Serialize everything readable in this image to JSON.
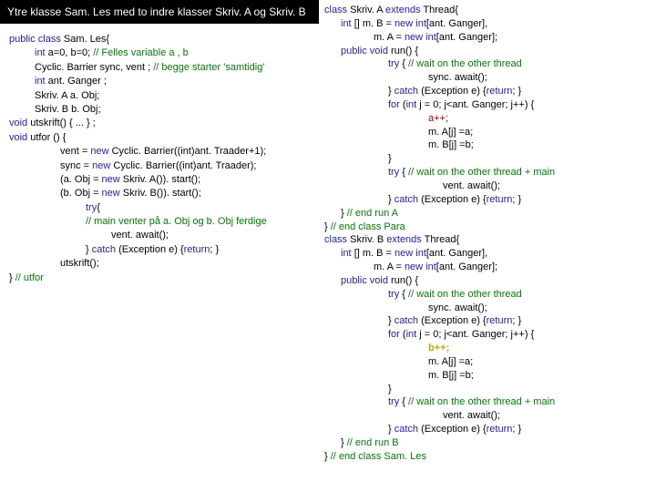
{
  "left": {
    "title": "Ytre klasse Sam. Les med to indre klasser Skriv. A og Skriv. B",
    "lines": [
      {
        "cls": "",
        "spans": [
          {
            "c": "kw-blue",
            "t": "public class "
          },
          {
            "t": "Sam. Les{"
          }
        ]
      },
      {
        "cls": "indent1",
        "spans": [
          {
            "c": "kw-blue",
            "t": "int"
          },
          {
            "t": "  a=0, b=0;                   "
          },
          {
            "c": "kw-green",
            "t": "// Felles variable a , b"
          }
        ]
      },
      {
        "cls": "indent1",
        "spans": [
          {
            "t": "Cyclic. Barrier sync, vent ; "
          },
          {
            "c": "kw-green",
            "t": "// begge starter 'samtidig'"
          }
        ]
      },
      {
        "cls": "indent1",
        "spans": [
          {
            "c": "kw-blue",
            "t": "int"
          },
          {
            "t": " ant. Ganger ;"
          }
        ]
      },
      {
        "cls": "indent1",
        "spans": [
          {
            "t": "Skriv. A a. Obj;"
          }
        ]
      },
      {
        "cls": "indent1",
        "spans": [
          {
            "t": "Skriv. B b. Obj;"
          }
        ]
      },
      {
        "cls": "",
        "spans": [
          {
            "t": " "
          }
        ]
      },
      {
        "cls": "",
        "spans": [
          {
            "c": "kw-blue",
            "t": "void "
          },
          {
            "t": "utskrift() {   ...   } ;"
          }
        ]
      },
      {
        "cls": "",
        "spans": [
          {
            "t": " "
          }
        ]
      },
      {
        "cls": "",
        "spans": [
          {
            "c": "kw-blue",
            "t": "void"
          },
          {
            "t": "  utfor () {"
          }
        ]
      },
      {
        "cls": "",
        "spans": [
          {
            "t": " "
          }
        ]
      },
      {
        "cls": "indent2",
        "spans": [
          {
            "t": "vent = "
          },
          {
            "c": "kw-blue",
            "t": "new"
          },
          {
            "t": " Cyclic. Barrier((int)ant. Traader+1);"
          }
        ]
      },
      {
        "cls": "indent2",
        "spans": [
          {
            "t": "sync = "
          },
          {
            "c": "kw-blue",
            "t": "new"
          },
          {
            "t": " Cyclic. Barrier((int)ant. Traader);"
          }
        ]
      },
      {
        "cls": "",
        "spans": [
          {
            "t": " "
          }
        ]
      },
      {
        "cls": "indent2",
        "spans": [
          {
            "t": "(a. Obj =  "
          },
          {
            "c": "kw-blue",
            "t": "new"
          },
          {
            "t": " Skriv. A()). start();"
          }
        ]
      },
      {
        "cls": "indent2",
        "spans": [
          {
            "t": "(b. Obj =  "
          },
          {
            "c": "kw-blue",
            "t": "new"
          },
          {
            "t": " Skriv. B()). start();"
          }
        ]
      },
      {
        "cls": "",
        "spans": [
          {
            "t": " "
          }
        ]
      },
      {
        "cls": "indent3",
        "spans": [
          {
            "c": "kw-blue",
            "t": "try"
          },
          {
            "t": "{"
          }
        ]
      },
      {
        "cls": "indent3",
        "spans": [
          {
            "c": "kw-green",
            "t": "   // main venter på a. Obj og b. Obj ferdige"
          }
        ]
      },
      {
        "cls": "indent4",
        "spans": [
          {
            "t": "vent. await();"
          }
        ]
      },
      {
        "cls": "indent3",
        "spans": [
          {
            "t": "} "
          },
          {
            "c": "kw-blue",
            "t": "catch"
          },
          {
            "t": " (Exception e) {"
          },
          {
            "c": "kw-blue",
            "t": "return"
          },
          {
            "t": "; }"
          }
        ]
      },
      {
        "cls": "indent2",
        "spans": [
          {
            "t": "utskrift();"
          }
        ]
      },
      {
        "cls": "",
        "spans": [
          {
            "t": "} "
          },
          {
            "c": "kw-green",
            "t": "// utfor"
          }
        ]
      }
    ]
  },
  "right": {
    "lines": [
      {
        "cls": "r-i0",
        "spans": [
          {
            "c": "kw-blue",
            "t": "class "
          },
          {
            "t": "Skriv. A "
          },
          {
            "c": "kw-blue",
            "t": "extends"
          },
          {
            "t": " Thread{"
          }
        ]
      },
      {
        "cls": "r-i1",
        "spans": [
          {
            "c": "kw-blue",
            "t": "int "
          },
          {
            "t": "[] m. B = "
          },
          {
            "c": "kw-blue",
            "t": "new int"
          },
          {
            "t": "[ant. Ganger],"
          }
        ]
      },
      {
        "cls": "r-i2",
        "spans": [
          {
            "t": "m. A = "
          },
          {
            "c": "kw-blue",
            "t": "new int"
          },
          {
            "t": "[ant. Ganger];"
          }
        ]
      },
      {
        "cls": "r-i1",
        "spans": [
          {
            "c": "kw-blue",
            "t": "public void "
          },
          {
            "t": "run() {"
          }
        ]
      },
      {
        "cls": "r-i3",
        "spans": [
          {
            "c": "kw-blue",
            "t": "try"
          },
          {
            "t": " {  "
          },
          {
            "c": "kw-green",
            "t": "// wait on the other thread"
          }
        ]
      },
      {
        "cls": "r-i5",
        "spans": [
          {
            "t": "sync. await();"
          }
        ]
      },
      {
        "cls": "r-i3",
        "spans": [
          {
            "t": "} "
          },
          {
            "c": "kw-blue",
            "t": "catch"
          },
          {
            "t": " (Exception e) {"
          },
          {
            "c": "kw-blue",
            "t": "return"
          },
          {
            "t": "; }"
          }
        ]
      },
      {
        "cls": "r-i0",
        "spans": [
          {
            "t": " "
          }
        ]
      },
      {
        "cls": "r-i3",
        "spans": [
          {
            "c": "kw-blue",
            "t": "for"
          },
          {
            "t": " ("
          },
          {
            "c": "kw-blue",
            "t": "int "
          },
          {
            "t": "j = 0; j<ant. Ganger; j++) {"
          }
        ]
      },
      {
        "cls": "r-i5",
        "spans": [
          {
            "c": "kw-red",
            "t": "a++;"
          }
        ]
      },
      {
        "cls": "r-i5",
        "spans": [
          {
            "t": "m. A[j] =a;"
          }
        ]
      },
      {
        "cls": "r-i5",
        "spans": [
          {
            "t": "m. B[j] =b;"
          }
        ]
      },
      {
        "cls": "r-i3",
        "spans": [
          {
            "t": "}"
          }
        ]
      },
      {
        "cls": "r-i3",
        "spans": [
          {
            "c": "kw-blue",
            "t": "try"
          },
          {
            "t": " {  "
          },
          {
            "c": "kw-green",
            "t": "// wait on the other thread + main"
          }
        ]
      },
      {
        "cls": "r-i6",
        "spans": [
          {
            "t": "vent. await();"
          }
        ]
      },
      {
        "cls": "r-i3",
        "spans": [
          {
            "t": "} "
          },
          {
            "c": "kw-blue",
            "t": "catch"
          },
          {
            "t": " (Exception e) {"
          },
          {
            "c": "kw-blue",
            "t": "return"
          },
          {
            "t": "; }"
          }
        ]
      },
      {
        "cls": "r-i1",
        "spans": [
          {
            "t": "} "
          },
          {
            "c": "kw-green",
            "t": "// end run A"
          }
        ]
      },
      {
        "cls": "r-i0",
        "spans": [
          {
            "t": "} "
          },
          {
            "c": "kw-green",
            "t": "// end class Para"
          }
        ]
      },
      {
        "cls": "r-i0",
        "spans": [
          {
            "t": " "
          }
        ]
      },
      {
        "cls": "r-i0",
        "spans": [
          {
            "c": "kw-blue",
            "t": "class "
          },
          {
            "t": "Skriv. B "
          },
          {
            "c": "kw-blue",
            "t": "extends"
          },
          {
            "t": " Thread{"
          }
        ]
      },
      {
        "cls": "r-i1",
        "spans": [
          {
            "c": "kw-blue",
            "t": "int "
          },
          {
            "t": "[] m. B = "
          },
          {
            "c": "kw-blue",
            "t": "new int"
          },
          {
            "t": "[ant. Ganger],"
          }
        ]
      },
      {
        "cls": "r-i2",
        "spans": [
          {
            "t": "m. A = "
          },
          {
            "c": "kw-blue",
            "t": "new int"
          },
          {
            "t": "[ant. Ganger];"
          }
        ]
      },
      {
        "cls": "r-i1",
        "spans": [
          {
            "c": "kw-blue",
            "t": "public void "
          },
          {
            "t": "run() {"
          }
        ]
      },
      {
        "cls": "r-i3",
        "spans": [
          {
            "c": "kw-blue",
            "t": "try"
          },
          {
            "t": " {  "
          },
          {
            "c": "kw-green",
            "t": "// wait on the other thread"
          }
        ]
      },
      {
        "cls": "r-i5",
        "spans": [
          {
            "t": "sync. await();"
          }
        ]
      },
      {
        "cls": "r-i3",
        "spans": [
          {
            "t": "} "
          },
          {
            "c": "kw-blue",
            "t": "catch"
          },
          {
            "t": " (Exception e) {"
          },
          {
            "c": "kw-blue",
            "t": "return"
          },
          {
            "t": "; }"
          }
        ]
      },
      {
        "cls": "r-i0",
        "spans": [
          {
            "t": " "
          }
        ]
      },
      {
        "cls": "r-i3",
        "spans": [
          {
            "c": "kw-blue",
            "t": "for"
          },
          {
            "t": " ("
          },
          {
            "c": "kw-blue",
            "t": "int "
          },
          {
            "t": "j = 0; j<ant. Ganger; j++) {"
          }
        ]
      },
      {
        "cls": "r-i5",
        "spans": [
          {
            "c": "kw-yellow",
            "t": "b++;"
          }
        ]
      },
      {
        "cls": "r-i5",
        "spans": [
          {
            "t": "m. A[j] =a;"
          }
        ]
      },
      {
        "cls": "r-i5",
        "spans": [
          {
            "t": "m. B[j] =b;"
          }
        ]
      },
      {
        "cls": "r-i3",
        "spans": [
          {
            "t": "}"
          }
        ]
      },
      {
        "cls": "r-i3",
        "spans": [
          {
            "c": "kw-blue",
            "t": "try"
          },
          {
            "t": " {  "
          },
          {
            "c": "kw-green",
            "t": "// wait on the other thread + main"
          }
        ]
      },
      {
        "cls": "r-i6",
        "spans": [
          {
            "t": "vent. await();"
          }
        ]
      },
      {
        "cls": "r-i3",
        "spans": [
          {
            "t": "} "
          },
          {
            "c": "kw-blue",
            "t": "catch"
          },
          {
            "t": " (Exception e) {"
          },
          {
            "c": "kw-blue",
            "t": "return"
          },
          {
            "t": "; }"
          }
        ]
      },
      {
        "cls": "r-i1",
        "spans": [
          {
            "t": "} "
          },
          {
            "c": "kw-green",
            "t": "// end run B"
          }
        ]
      },
      {
        "cls": "r-i0",
        "spans": [
          {
            "t": "} "
          },
          {
            "c": "kw-green",
            "t": "// end class Sam. Les"
          }
        ]
      }
    ]
  }
}
